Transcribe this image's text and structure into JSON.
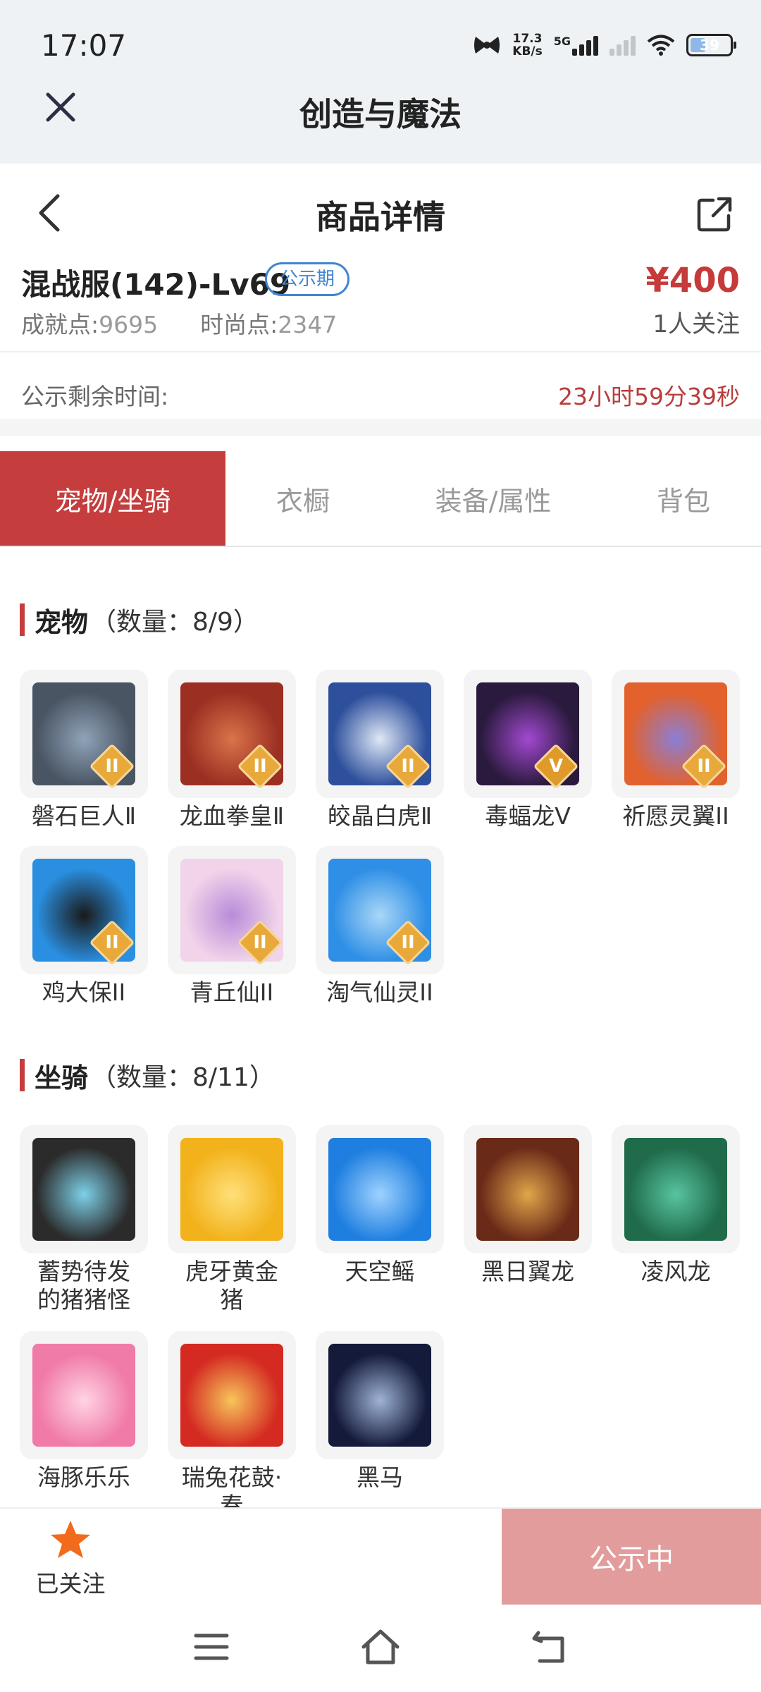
{
  "status_bar": {
    "time": "17:07",
    "net_speed_value": "17.3",
    "net_speed_unit": "KB/s",
    "network_type": "5G",
    "battery": "39",
    "battery_level_percent": 39
  },
  "web_header": {
    "title": "创造与魔法",
    "close_icon": "close-icon"
  },
  "page_header": {
    "title": "商品详情",
    "back_icon": "chevron-left-icon",
    "share_icon": "share-icon"
  },
  "product": {
    "name": "混战服(142)-Lv69",
    "status_tag": "公示期",
    "achievement_label": "成就点:",
    "achievement_value": "9695",
    "fashion_label": "时尚点:",
    "fashion_value": "2347",
    "price": "¥400",
    "watchers": "1人关注"
  },
  "timer": {
    "label": "公示剩余时间:",
    "value": "23小时59分39秒"
  },
  "tabs": [
    {
      "label": "宠物/坐骑",
      "active": true
    },
    {
      "label": "衣橱",
      "active": false
    },
    {
      "label": "装备/属性",
      "active": false
    },
    {
      "label": "背包",
      "active": false
    }
  ],
  "pets": {
    "title": "宠物",
    "count": "（数量：8/9）",
    "items": [
      {
        "name": "磐石巨人Ⅱ",
        "badge": "II",
        "colors": [
          "#4a5563",
          "#8fa3b8"
        ]
      },
      {
        "name": "龙血拳皇Ⅱ",
        "badge": "II",
        "colors": [
          "#9b2f22",
          "#d9744a"
        ]
      },
      {
        "name": "皎晶白虎Ⅱ",
        "badge": "II",
        "colors": [
          "#2d4f9c",
          "#dfe8f5"
        ]
      },
      {
        "name": "毒蝠龙Ⅴ",
        "badge": "V",
        "colors": [
          "#2a1a3d",
          "#a349d1"
        ]
      },
      {
        "name": "祈愿灵翼II",
        "badge": "II",
        "colors": [
          "#e2612d",
          "#8a7fd6"
        ]
      },
      {
        "name": "鸡大保II",
        "badge": "II",
        "colors": [
          "#2a8fe0",
          "#1a1a1a"
        ]
      },
      {
        "name": "青丘仙II",
        "badge": "II",
        "colors": [
          "#f1d4ea",
          "#b88cd9"
        ]
      },
      {
        "name": "淘气仙灵II",
        "badge": "II",
        "colors": [
          "#2f8fe6",
          "#a9d7f7"
        ]
      }
    ]
  },
  "mounts": {
    "title": "坐骑",
    "count": "（数量：8/11）",
    "items": [
      {
        "name": "蓄势待发的猪猪怪",
        "colors": [
          "#2b2b2b",
          "#7dd0e8"
        ]
      },
      {
        "name": "虎牙黄金猪",
        "colors": [
          "#f2b21b",
          "#ffe07a"
        ]
      },
      {
        "name": "天空鳐",
        "colors": [
          "#1f7fe0",
          "#9ed2ff"
        ]
      },
      {
        "name": "黑日翼龙",
        "colors": [
          "#6a2a18",
          "#e1a64a"
        ]
      },
      {
        "name": "凌风龙",
        "colors": [
          "#1f6b4a",
          "#58c4a0"
        ]
      },
      {
        "name": "海豚乐乐",
        "colors": [
          "#f07aa8",
          "#ffd4e4"
        ]
      },
      {
        "name": "瑞兔花鼓·春",
        "colors": [
          "#d42a22",
          "#f7c55a"
        ]
      },
      {
        "name": "黑马",
        "colors": [
          "#141a3a",
          "#9fb3d6"
        ]
      }
    ]
  },
  "bottom_bar": {
    "follow_label": "已关注",
    "follow_icon": "star-icon",
    "status_button": "公示中"
  },
  "system_nav": {
    "menu_icon": "menu-icon",
    "home_icon": "home-icon",
    "back_icon": "back-icon"
  },
  "colors": {
    "accent": "#c53d3d",
    "tag_blue": "#3f86d4",
    "status_button": "#e29c9c",
    "star": "#f26a1b"
  }
}
